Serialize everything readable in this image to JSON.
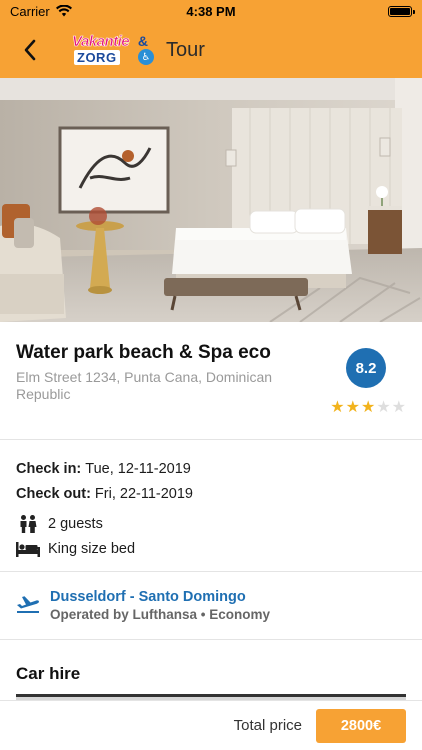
{
  "status_bar": {
    "carrier": "Carrier",
    "time": "4:38 PM",
    "icons": [
      "wifi-icon",
      "battery-icon"
    ]
  },
  "nav": {
    "back_icon": "chevron-left-icon",
    "logo_line1": "Vakantie",
    "logo_amp": "&",
    "logo_line2": "ZORG",
    "title": "Tour",
    "accent_color": "#f7a234"
  },
  "hotel": {
    "name": "Water park beach & Spa eco",
    "address": "Elm Street 1234, Punta Cana, Dominican Republic",
    "rating": "8.2",
    "stars": 3,
    "stars_max": 5,
    "rating_color": "#1f6fb2"
  },
  "stay": {
    "check_in_label": "Check in:",
    "check_in_value": "Tue, 12-11-2019",
    "check_out_label": "Check out:",
    "check_out_value": "Fri, 22-11-2019",
    "guests": "2 guests",
    "bed": "King size bed",
    "guests_icon": "people-icon",
    "bed_icon": "bed-icon"
  },
  "flight": {
    "icon": "plane-departure-icon",
    "route": "Dusseldorf - Santo Domingo",
    "operator": "Operated by Lufthansa • Economy"
  },
  "car_hire": {
    "title": "Car hire"
  },
  "footer": {
    "total_label": "Total price",
    "price": "2800€"
  }
}
